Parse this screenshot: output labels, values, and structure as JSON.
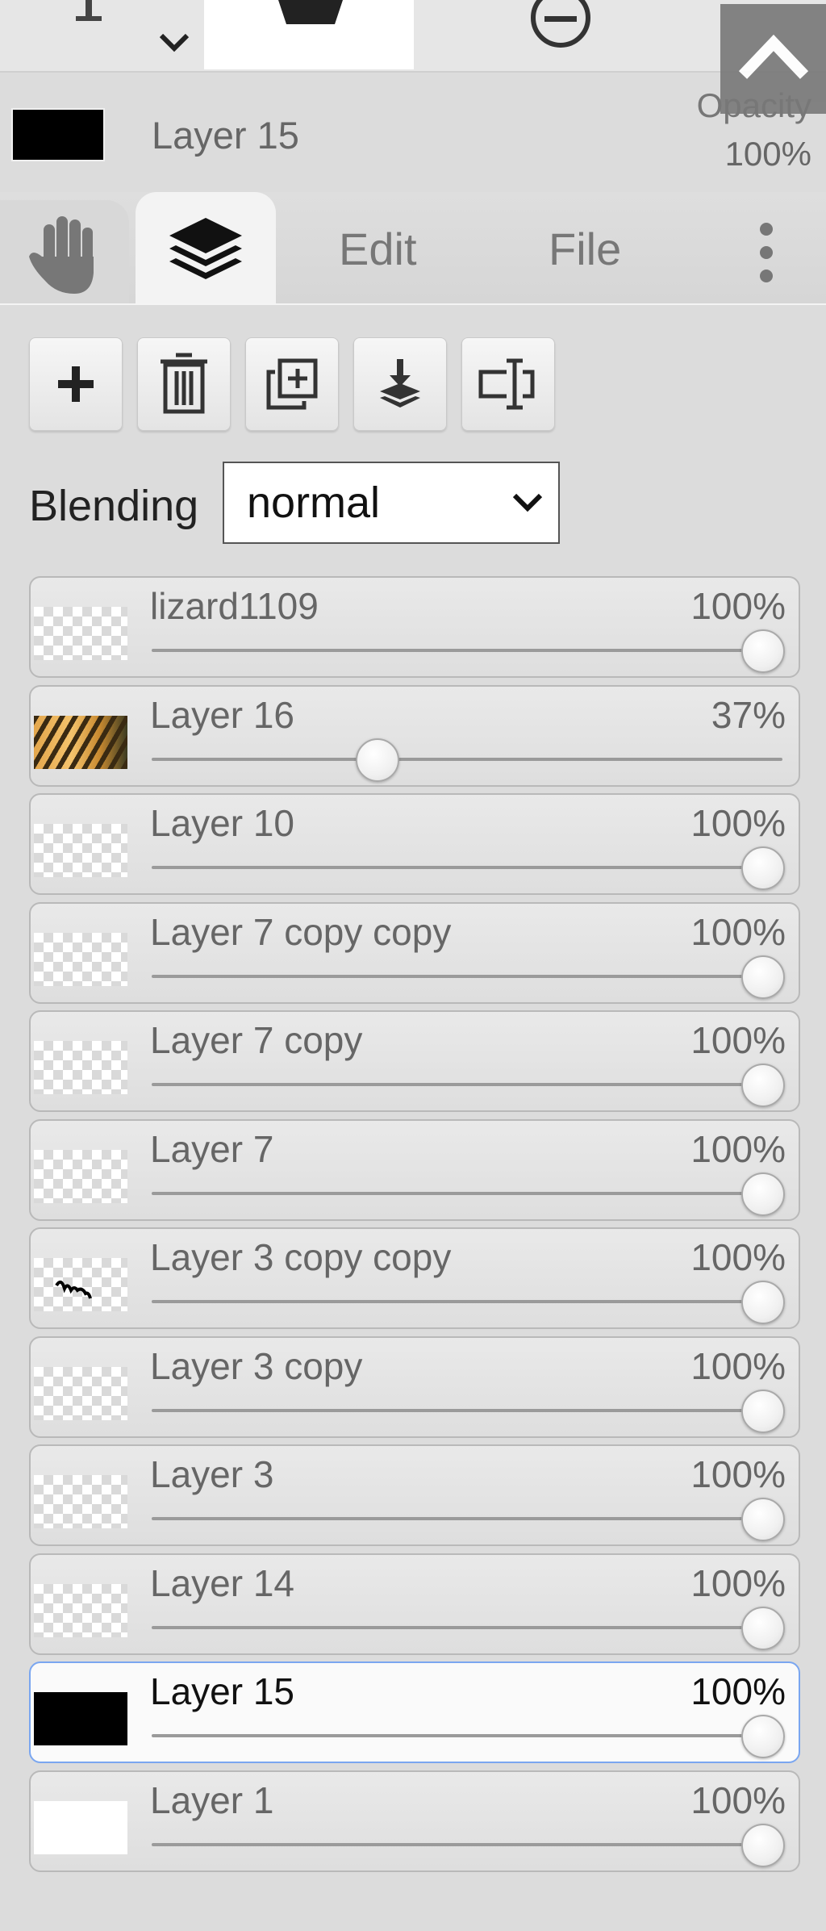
{
  "current_layer": {
    "name": "Layer 15",
    "swatch_color": "#000000",
    "opacity_label": "Opacity",
    "opacity_value": "100%"
  },
  "top_toolbar": {
    "icons": [
      "pen-tool-icon",
      "chevron-down-icon",
      "shape-icon",
      "minus-circle-icon",
      "collapse-up-icon"
    ]
  },
  "tabs": [
    {
      "id": "hand",
      "icon": "hand-icon",
      "label": ""
    },
    {
      "id": "layers",
      "icon": "layers-icon",
      "label": "",
      "active": true
    },
    {
      "id": "edit",
      "label": "Edit"
    },
    {
      "id": "file",
      "label": "File"
    },
    {
      "id": "more",
      "icon": "more-vertical-icon",
      "label": ""
    }
  ],
  "layer_actions": [
    {
      "icon": "add-layer-icon"
    },
    {
      "icon": "delete-layer-icon"
    },
    {
      "icon": "duplicate-layer-icon"
    },
    {
      "icon": "merge-down-icon"
    },
    {
      "icon": "rename-layer-icon"
    }
  ],
  "blending": {
    "label": "Blending",
    "value": "normal"
  },
  "layers": [
    {
      "name": "lizard1109",
      "opacity": "100%",
      "opacity_value": 100,
      "thumb": "transparent"
    },
    {
      "name": "Layer 16",
      "opacity": "37%",
      "opacity_value": 37,
      "thumb": "photo"
    },
    {
      "name": "Layer 10",
      "opacity": "100%",
      "opacity_value": 100,
      "thumb": "transparent"
    },
    {
      "name": "Layer 7 copy copy",
      "opacity": "100%",
      "opacity_value": 100,
      "thumb": "transparent"
    },
    {
      "name": "Layer 7 copy",
      "opacity": "100%",
      "opacity_value": 100,
      "thumb": "transparent"
    },
    {
      "name": "Layer 7",
      "opacity": "100%",
      "opacity_value": 100,
      "thumb": "transparent"
    },
    {
      "name": "Layer 3 copy copy",
      "opacity": "100%",
      "opacity_value": 100,
      "thumb": "transparent-text"
    },
    {
      "name": "Layer 3 copy",
      "opacity": "100%",
      "opacity_value": 100,
      "thumb": "transparent"
    },
    {
      "name": "Layer 3",
      "opacity": "100%",
      "opacity_value": 100,
      "thumb": "transparent"
    },
    {
      "name": "Layer 14",
      "opacity": "100%",
      "opacity_value": 100,
      "thumb": "transparent"
    },
    {
      "name": "Layer 15",
      "opacity": "100%",
      "opacity_value": 100,
      "thumb": "black",
      "active": true
    },
    {
      "name": "Layer 1",
      "opacity": "100%",
      "opacity_value": 100,
      "thumb": "white"
    }
  ],
  "colors": {
    "accent_active_border": "#7aa6f0",
    "panel_bg": "#dcdcdc"
  }
}
